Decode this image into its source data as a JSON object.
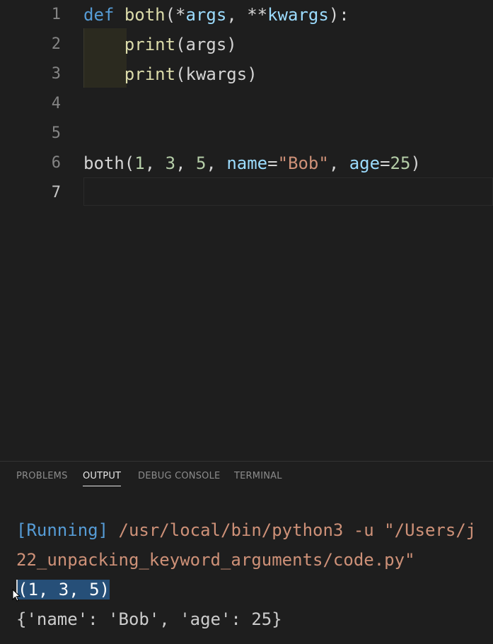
{
  "editor": {
    "lines": [
      {
        "n": "1",
        "tokens": [
          [
            "kw",
            "def"
          ],
          [
            "op",
            " "
          ],
          [
            "fn",
            "both"
          ],
          [
            "op",
            "(*"
          ],
          [
            "par",
            "args"
          ],
          [
            "op",
            ", **"
          ],
          [
            "par",
            "kwargs"
          ],
          [
            "op",
            "):"
          ]
        ]
      },
      {
        "n": "2",
        "tokens": [
          [
            "op",
            "    "
          ],
          [
            "fn",
            "print"
          ],
          [
            "op",
            "(args)"
          ]
        ]
      },
      {
        "n": "3",
        "tokens": [
          [
            "op",
            "    "
          ],
          [
            "fn",
            "print"
          ],
          [
            "op",
            "(kwargs)"
          ]
        ]
      },
      {
        "n": "4",
        "tokens": []
      },
      {
        "n": "5",
        "tokens": []
      },
      {
        "n": "6",
        "tokens": [
          [
            "op",
            "both("
          ],
          [
            "num",
            "1"
          ],
          [
            "op",
            ", "
          ],
          [
            "num",
            "3"
          ],
          [
            "op",
            ", "
          ],
          [
            "num",
            "5"
          ],
          [
            "op",
            ", "
          ],
          [
            "par",
            "name"
          ],
          [
            "op",
            "="
          ],
          [
            "str",
            "\"Bob\""
          ],
          [
            "op",
            ", "
          ],
          [
            "par",
            "age"
          ],
          [
            "op",
            "="
          ],
          [
            "num",
            "25"
          ],
          [
            "op",
            ")"
          ]
        ]
      },
      {
        "n": "7",
        "tokens": []
      }
    ]
  },
  "panel": {
    "tabs": [
      {
        "label": "PROBLEMS",
        "active": false
      },
      {
        "label": "OUTPUT",
        "active": true
      },
      {
        "label": "DEBUG CONSOLE",
        "active": false
      },
      {
        "label": "TERMINAL",
        "active": false
      }
    ],
    "output": {
      "running_tag": "[Running]",
      "running_cmd": " /usr/local/bin/python3 -u \"/Users/j",
      "path_cont": "22_unpacking_keyword_arguments/code.py\"",
      "tuple_line": "(1, 3, 5)",
      "dict_line": "{'name': 'Bob', 'age': 25}"
    }
  },
  "colors": {
    "background": "#1e1e1e",
    "keyword": "#569cd6",
    "function": "#dcdcaa",
    "parameter": "#9cdcfe",
    "number": "#b5cea8",
    "string": "#ce9178",
    "selection": "#264f78"
  },
  "icons": {
    "mouse_cursor": "arrow-pointer-icon"
  }
}
